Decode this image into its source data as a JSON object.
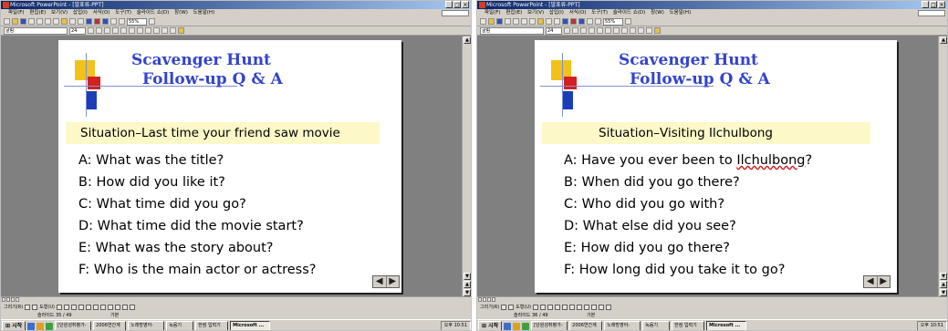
{
  "left": {
    "titlebar": "Microsoft PowerPoint - [말표류-PPT]",
    "menu": [
      "파일(F)",
      "편집(E)",
      "보기(V)",
      "삽입(I)",
      "서식(O)",
      "도구(T)",
      "슬라이드 쇼(D)",
      "창(W)",
      "도움말(H)"
    ],
    "zoom": "55%",
    "font_name": "굴림",
    "font_size": "24",
    "slide": {
      "title_line1": "Scavenger Hunt",
      "title_line2": "Follow-up Q & A",
      "situation": "Situation–Last time your friend saw movie",
      "questions": [
        "A: What was the title?",
        "B: How did you like it?",
        "C: What time did you go?",
        "D: What time did the movie start?",
        "E: What was the story about?",
        "F: Who is the main actor or actress?"
      ]
    },
    "draw_label": "그리기(R)",
    "autoshape_label": "도형(U)",
    "status_slide": "슬라이드 35 / 49",
    "status_design": "기본",
    "taskbar": {
      "start": "시작",
      "tasks": [
        "[단원성취평가-",
        "2006연간계",
        "노래방영어-",
        "녹음기",
        "한컴 입력기",
        "Microsoft ..."
      ],
      "clock": "오후 10:51"
    }
  },
  "right": {
    "titlebar": "Microsoft PowerPoint - [말표류-PPT]",
    "menu": [
      "파일(F)",
      "편집(E)",
      "보기(V)",
      "삽입(I)",
      "서식(O)",
      "도구(T)",
      "슬라이드 쇼(D)",
      "창(W)",
      "도움말(H)"
    ],
    "zoom": "55%",
    "font_name": "굴림",
    "font_size": "24",
    "slide": {
      "title_line1": "Scavenger Hunt",
      "title_line2": "Follow-up Q & A",
      "situation": "Situation–Visiting Ilchulbong",
      "questions": [
        "A: Have you ever been to ",
        "B: When did you go there?",
        "C: Who did you go with?",
        "D: What else did you see?",
        "E: How did you go there?",
        "F: How long did you take it to go?"
      ],
      "question_a_place": "Ilchulbong",
      "question_a_end": "?"
    },
    "draw_label": "그리기(R)",
    "autoshape_label": "도형(U)",
    "status_slide": "슬라이드 36 / 49",
    "status_design": "기본",
    "taskbar": {
      "start": "시작",
      "tasks": [
        "[단원성취평가-",
        "2006연간계",
        "노래방영어-",
        "녹음기",
        "한컴 입력기",
        "Microsoft ..."
      ],
      "clock": "오후 10:51"
    }
  },
  "colors": {
    "title_blue": "#3344cc",
    "situation_band": "#fdf8c8",
    "deco_yellow": "#f2c21a",
    "deco_red": "#d42020",
    "deco_blue": "#1c3db8",
    "workspace_gray": "#808080"
  },
  "icons": [
    "powerpoint-icon",
    "minimize-icon",
    "maximize-icon",
    "close-icon",
    "prev-slide-icon",
    "next-slide-icon",
    "start-icon"
  ]
}
